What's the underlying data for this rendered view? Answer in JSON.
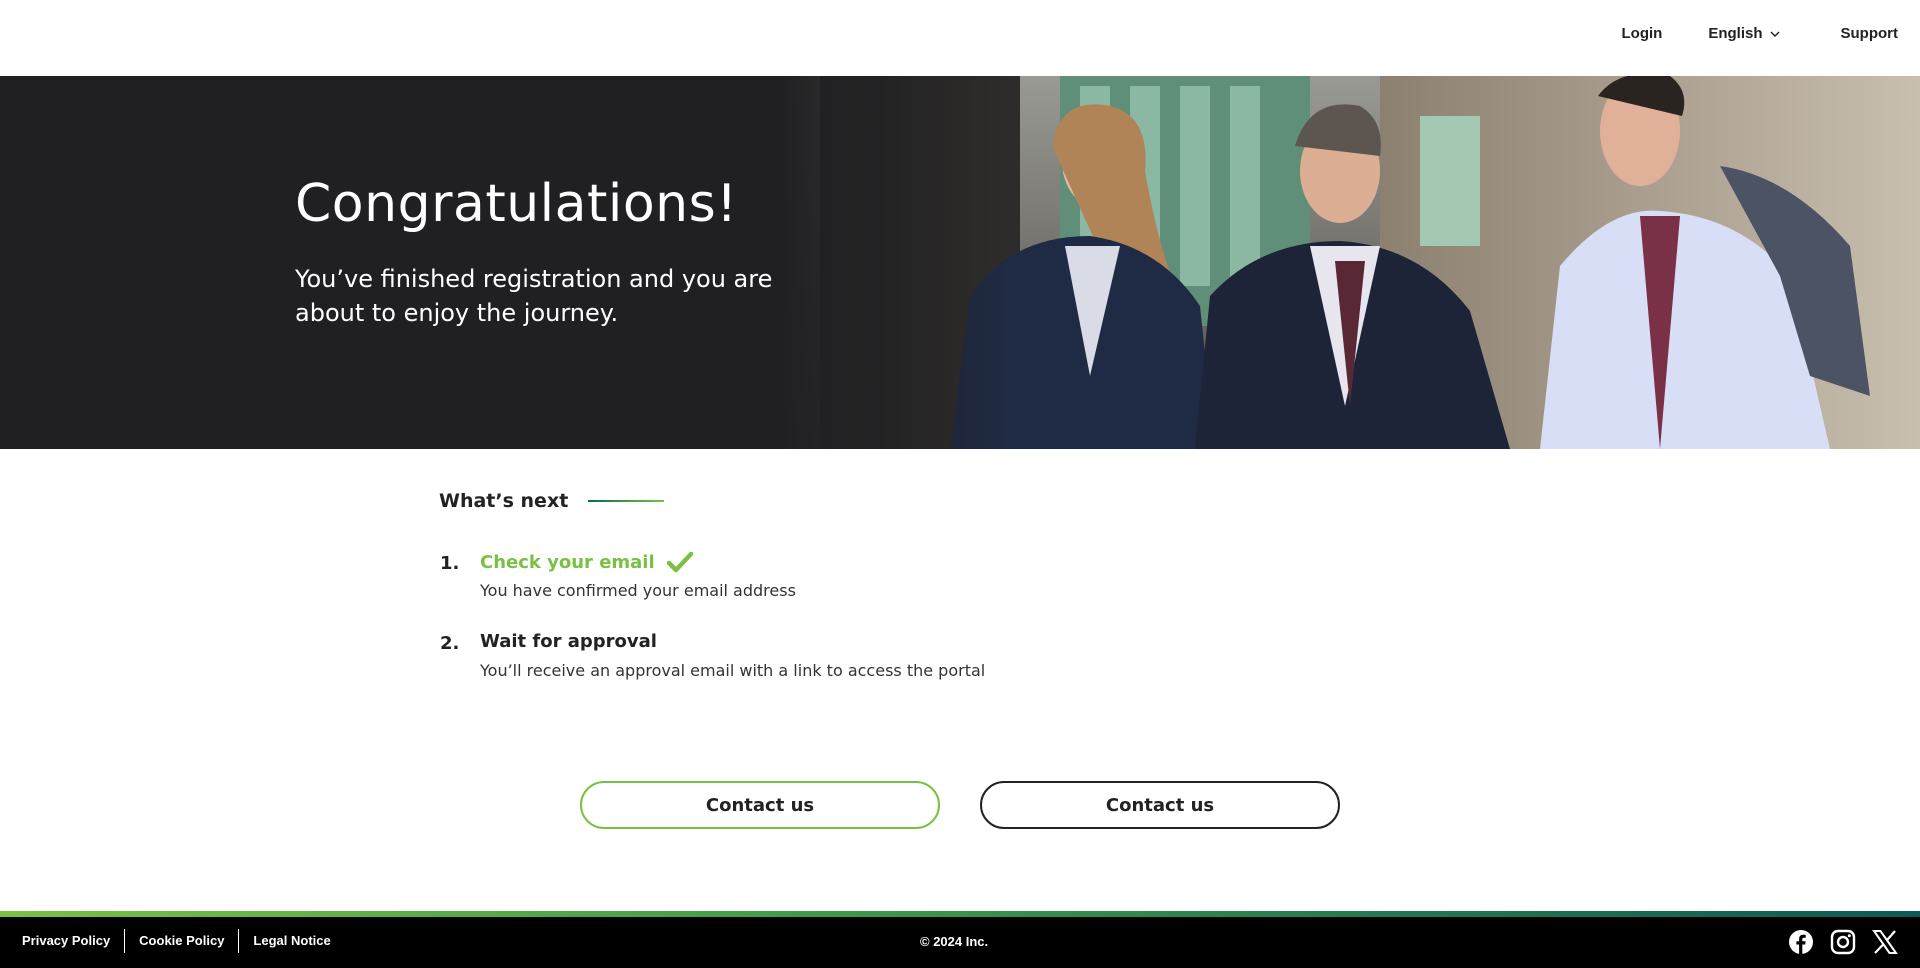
{
  "header": {
    "nav": {
      "login": "Login",
      "language": "English",
      "support": "Support"
    }
  },
  "hero": {
    "title": "Congratulations!",
    "subtitle": "You’ve finished registration and you are about to enjoy the journey.",
    "image": "three-business-people-walking-photo"
  },
  "whats_next": {
    "title": "What’s next",
    "steps": [
      {
        "number": "1.",
        "title": "Check your email",
        "description": "You have confirmed your email address",
        "completed": true,
        "status_icon": "checkmark-icon"
      },
      {
        "number": "2.",
        "title": "Wait for approval",
        "description": "You’ll receive an approval email with a link to access the portal",
        "completed": false
      }
    ]
  },
  "actions": {
    "primary_label": "Contact us",
    "secondary_label": "Contact us"
  },
  "footer": {
    "links": [
      "Privacy Policy",
      "Cookie Policy",
      "Legal Notice"
    ],
    "copyright": "© 2024   Inc.",
    "social": [
      "facebook-icon",
      "instagram-icon",
      "x-icon"
    ]
  },
  "colors": {
    "accent_green": "#7ac143",
    "dark_teal": "#0b5a55",
    "hero_bg": "#202022",
    "footer_bg": "#000000"
  }
}
